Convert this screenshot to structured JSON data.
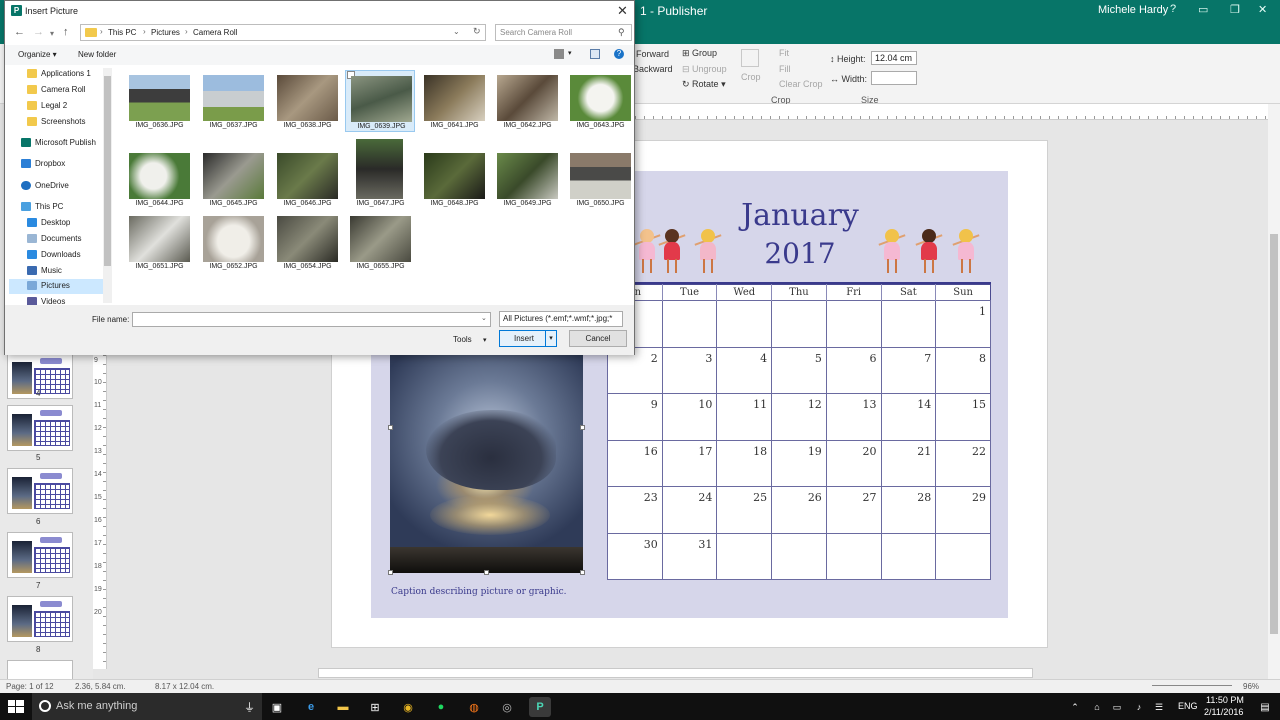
{
  "titlebar": {
    "app_title": "1 - Publisher",
    "user": "Michele Hardy",
    "help": "?",
    "ribbon_toggle": "▭",
    "minimize": "—",
    "restore": "❐",
    "close": "✕"
  },
  "ribbon": {
    "forward": "Forward",
    "backward": "Backward",
    "group": "Group",
    "ungroup": "Ungroup",
    "rotate": "Rotate",
    "crop": "Crop",
    "fit": "Fit",
    "fill": "Fill",
    "clear_crop": "Clear Crop",
    "height_label": "Height:",
    "height_value": "12.04 cm",
    "width_label": "Width:",
    "width_value": "",
    "group_crop": "Crop",
    "group_size": "Size"
  },
  "thumbnails": [
    {
      "num": "4"
    },
    {
      "num": "5"
    },
    {
      "num": "6"
    },
    {
      "num": "7"
    },
    {
      "num": "8"
    }
  ],
  "vruler_numbers": [
    "9",
    "10",
    "11",
    "12",
    "13",
    "14",
    "15",
    "16",
    "17",
    "18",
    "19",
    "20"
  ],
  "calendar": {
    "month": "January",
    "year": "2017",
    "days": [
      "on",
      "Tue",
      "Wed",
      "Thu",
      "Fri",
      "Sat",
      "Sun"
    ],
    "weeks": [
      [
        "",
        "",
        "",
        "",
        "",
        "",
        "1"
      ],
      [
        "2",
        "3",
        "4",
        "5",
        "6",
        "7",
        "8"
      ],
      [
        "9",
        "10",
        "11",
        "12",
        "13",
        "14",
        "15"
      ],
      [
        "16",
        "17",
        "18",
        "19",
        "20",
        "21",
        "22"
      ],
      [
        "23",
        "24",
        "25",
        "26",
        "27",
        "28",
        "29"
      ],
      [
        "30",
        "31",
        "",
        "",
        "",
        "",
        ""
      ]
    ],
    "caption": "Caption describing picture or graphic."
  },
  "statusbar": {
    "page": "Page: 1 of 12",
    "position": "2.36, 5.84 cm.",
    "size": "8.17 x 12.04 cm.",
    "zoom": "96%"
  },
  "taskbar": {
    "search_placeholder": "Ask me anything",
    "lang": "ENG",
    "time": "11:50 PM",
    "date": "2/11/2016"
  },
  "dialog": {
    "title": "Insert Picture",
    "breadcrumbs": [
      "This PC",
      "Pictures",
      "Camera Roll"
    ],
    "search_placeholder": "Search Camera Roll",
    "organize": "Organize ▾",
    "new_folder": "New folder",
    "nav_items": [
      {
        "label": "Applications 1",
        "icon": "folder-icon"
      },
      {
        "label": "Camera Roll",
        "icon": "folder-icon"
      },
      {
        "label": "Legal 2",
        "icon": "folder-icon"
      },
      {
        "label": "Screenshots",
        "icon": "folder-icon"
      },
      {
        "label": "Microsoft Publish",
        "icon": "publisher-icon"
      },
      {
        "label": "Dropbox",
        "icon": "dropbox-icon"
      },
      {
        "label": "OneDrive",
        "icon": "cloud-icon"
      },
      {
        "label": "This PC",
        "icon": "computer-icon"
      },
      {
        "label": "Desktop",
        "icon": "desktop-icon"
      },
      {
        "label": "Documents",
        "icon": "documents-icon"
      },
      {
        "label": "Downloads",
        "icon": "download-icon"
      },
      {
        "label": "Music",
        "icon": "music-icon"
      },
      {
        "label": "Pictures",
        "icon": "pictures-icon"
      },
      {
        "label": "Videos",
        "icon": "video-icon"
      }
    ],
    "files": [
      "IMG_0636.JPG",
      "IMG_0637.JPG",
      "IMG_0638.JPG",
      "IMG_0639.JPG",
      "IMG_0641.JPG",
      "IMG_0642.JPG",
      "IMG_0643.JPG",
      "IMG_0644.JPG",
      "IMG_0645.JPG",
      "IMG_0646.JPG",
      "IMG_0647.JPG",
      "IMG_0648.JPG",
      "IMG_0649.JPG",
      "IMG_0650.JPG",
      "IMG_0651.JPG",
      "IMG_0652.JPG",
      "IMG_0654.JPG",
      "IMG_0655.JPG"
    ],
    "file_name_label": "File name:",
    "file_name_value": "",
    "file_type": "All Pictures (*.emf;*.wmf;*.jpg;*",
    "tools": "Tools",
    "insert": "Insert",
    "cancel": "Cancel"
  }
}
